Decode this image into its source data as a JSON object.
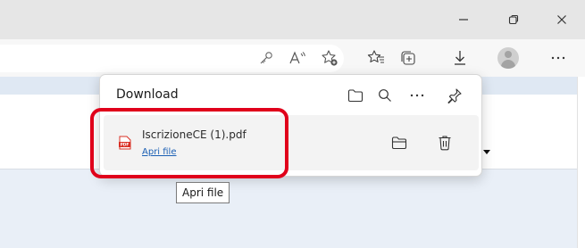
{
  "window": {
    "controls": [
      "minimize-icon",
      "restore-icon",
      "close-icon"
    ]
  },
  "toolbar": {
    "icons": [
      "key-icon",
      "read-aloud-icon",
      "add-favorite-icon",
      "favorites-icon",
      "collections-icon",
      "downloads-icon",
      "profile-avatar",
      "more-icon"
    ]
  },
  "downloads": {
    "title": "Download",
    "header_icons": [
      "open-folder-icon",
      "search-icon",
      "more-options-icon",
      "pin-icon"
    ],
    "items": [
      {
        "filename": "IscrizioneCE (1).pdf",
        "open_label": "Apri file",
        "file_icon": "pdf-icon",
        "actions": [
          "show-in-folder-icon",
          "delete-icon"
        ]
      }
    ]
  },
  "tooltip": {
    "text": "Apri file"
  },
  "colors": {
    "highlight": "#e0001b",
    "link": "#1a5fb4",
    "pdf": "#d93025"
  }
}
